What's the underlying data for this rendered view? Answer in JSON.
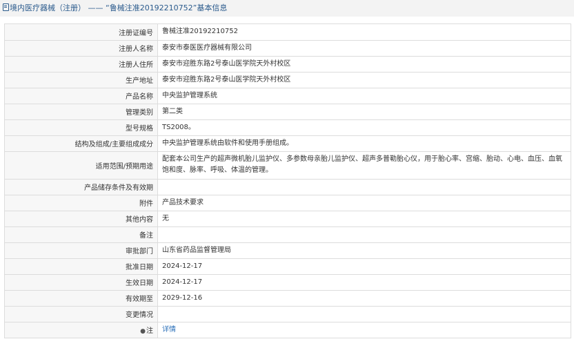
{
  "header": {
    "title": "境内医疗器械（注册） —— “鲁械注准20192210752”基本信息"
  },
  "fields": [
    {
      "label": "注册证编号",
      "value": "鲁械注准20192210752"
    },
    {
      "label": "注册人名称",
      "value": "泰安市泰医医疗器械有限公司"
    },
    {
      "label": "注册人住所",
      "value": "泰安市迎胜东路2号泰山医学院天外村校区"
    },
    {
      "label": "生产地址",
      "value": "泰安市迎胜东路2号泰山医学院天外村校区"
    },
    {
      "label": "产品名称",
      "value": "中央监护管理系统"
    },
    {
      "label": "管理类别",
      "value": "第二类"
    },
    {
      "label": "型号规格",
      "value": "TS2008。"
    },
    {
      "label": "结构及组成/主要组成成分",
      "value": "中央监护管理系统由软件和使用手册组成。"
    },
    {
      "label": "适用范围/预期用途",
      "value": "配套本公司生产的超声微机胎儿监护仪、多参数母亲胎儿监护仪、超声多普勒胎心仪，用于胎心率、宫缩、胎动、心电、血压、血氧饱和度、脉率、呼吸、体温的管理。"
    },
    {
      "label": "产品储存条件及有效期",
      "value": ""
    },
    {
      "label": "附件",
      "value": "产品技术要求"
    },
    {
      "label": "其他内容",
      "value": "无"
    },
    {
      "label": "备注",
      "value": ""
    },
    {
      "label": "审批部门",
      "value": "山东省药品监督管理局"
    },
    {
      "label": "批准日期",
      "value": "2024-12-17"
    },
    {
      "label": "生效日期",
      "value": "2024-12-17"
    },
    {
      "label": "有效期至",
      "value": "2029-12-16"
    },
    {
      "label": "变更情况",
      "value": ""
    }
  ],
  "note": {
    "label": "注",
    "icon": "lightbulb-icon",
    "link_text": "详情"
  }
}
